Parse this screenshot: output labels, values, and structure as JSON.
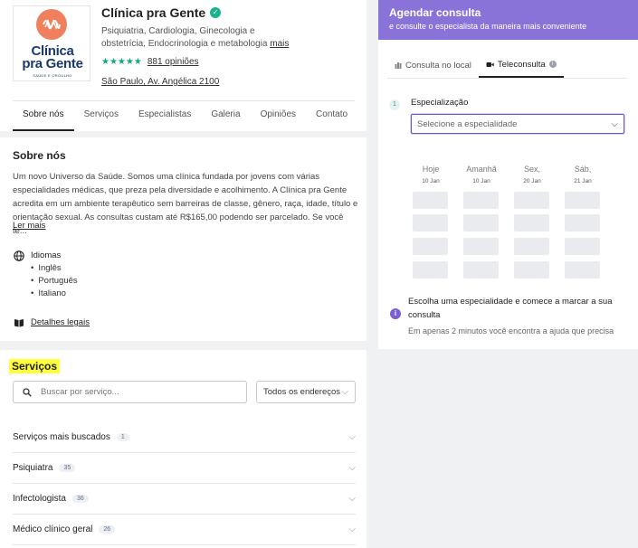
{
  "colors": {
    "brand_purple": "#8a73d8",
    "verified": "#19b28c",
    "stars": "#13a884",
    "highlight": "#ffff3c",
    "logo_circle": "#f07f5e"
  },
  "profile": {
    "logo": {
      "line1": "Clínica",
      "line2": "pra Gente",
      "tagline": "SAÚDE E ORGULHO"
    },
    "name": "Clínica pra Gente",
    "verified_icon": "check-badge-icon",
    "specialties": "Psiquiatria, Cardiologia, Ginecologia e obstetrícia, Endocrinologia e metabologia",
    "more_link": "mais",
    "stars": "★★★★★",
    "stars_value": 5,
    "reviews_link": "881 opiniões",
    "address": "São Paulo, Av. Angélica 2100",
    "tabs": [
      "Sobre nós",
      "Serviços",
      "Especialistas",
      "Galeria",
      "Opiniões",
      "Contato"
    ]
  },
  "about": {
    "title": "Sobre nós",
    "text": "Um novo Universo da Saúde. Somos uma clínica fundada por jovens com várias especialidades médicas, que preza pela diversidade e acolhimento. A Clínica pra Gente acredita em um ambiente terapêutico sem barreiras de classe, gênero, raça, idade, título e orientação sexual. As consultas custam até R$165,00 podendo ser parcelado. Se você te...",
    "read_more": "Ler mais",
    "languages_title": "Idiomas",
    "languages": [
      "Inglês",
      "Português",
      "Italiano"
    ],
    "legal_link": "Detalhes legais"
  },
  "services": {
    "title": "Serviços",
    "search_placeholder": "Buscar por serviço...",
    "address_filter": "Todos os endereços",
    "rows": [
      {
        "name": "Serviços mais buscados",
        "count": "1"
      },
      {
        "name": "Psiquiatra",
        "count": "35"
      },
      {
        "name": "Infectologista",
        "count": "36"
      },
      {
        "name": "Médico clínico geral",
        "count": "26"
      }
    ]
  },
  "booking": {
    "title": "Agendar consulta",
    "subtitle": "e consulte o especialista da maneira mais conveniente",
    "tabs": [
      "Consulta no local",
      "Teleconsulta"
    ],
    "step_number": "1",
    "step_label": "Especialização",
    "specialty_placeholder": "Selecione a especialidade",
    "days": [
      {
        "name": "Hoje",
        "date": "10 Jan"
      },
      {
        "name": "Amanhã",
        "date": "10 Jan"
      },
      {
        "name": "Sex,",
        "date": "20 Jan"
      },
      {
        "name": "Sáb,",
        "date": "21 Jan"
      }
    ],
    "note_main": "Escolha uma especialidade e comece a marcar a sua consulta",
    "note_sub": "Em apenas 2 minutos você encontra a ajuda que precisa"
  }
}
